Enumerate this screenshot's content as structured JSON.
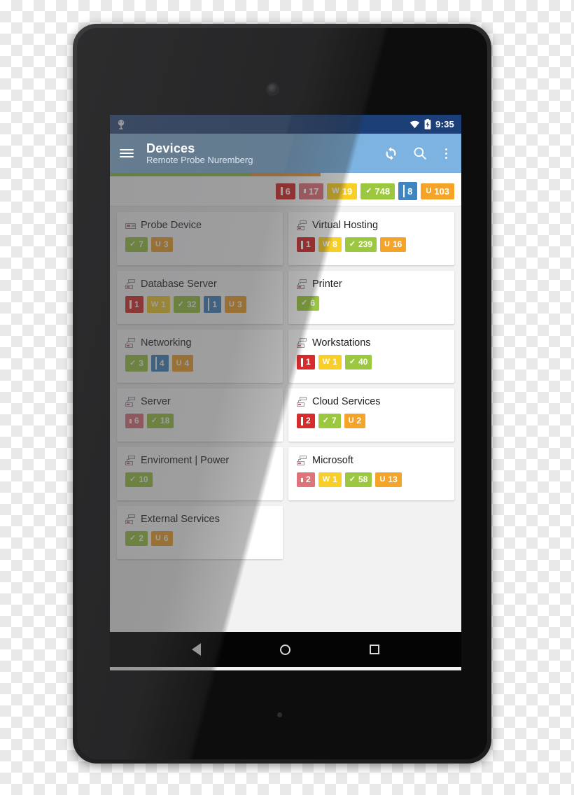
{
  "status_bar": {
    "app_icon": "prtg-probe-icon",
    "wifi_icon": "wifi-icon",
    "battery_icon": "battery-charging-icon",
    "time": "9:35"
  },
  "app_bar": {
    "menu_icon": "hamburger-menu-icon",
    "title": "Devices",
    "subtitle": "Remote Probe Nuremberg",
    "refresh_icon": "refresh-icon",
    "search_icon": "search-icon",
    "overflow_icon": "overflow-menu-icon"
  },
  "progress": {
    "green_percent": 40,
    "orange_percent": 20,
    "green_color": "#8ec640",
    "orange_color": "#ee9b33"
  },
  "status_colors": {
    "down": "#d92b2b",
    "down_acknowledged": "#e0737a",
    "warning": "#f7cf28",
    "up": "#9cc840",
    "paused": "#3f86c0",
    "unknown": "#f5a42a"
  },
  "totals": [
    {
      "icon": "down-icon",
      "glyph": "dots4",
      "count": "6",
      "state": "down"
    },
    {
      "icon": "down-ack-icon",
      "glyph": "colon",
      "count": "17",
      "state": "down_acknowledged"
    },
    {
      "icon": "warning-icon",
      "glyph": "W",
      "count": "19",
      "state": "warning"
    },
    {
      "icon": "up-icon",
      "glyph": "check",
      "count": "748",
      "state": "up"
    },
    {
      "icon": "paused-icon",
      "glyph": "pause",
      "count": "8",
      "state": "paused"
    },
    {
      "icon": "unknown-icon",
      "glyph": "U",
      "count": "103",
      "state": "unknown"
    }
  ],
  "cards": [
    {
      "title": "Probe Device",
      "icon": "probe-device-icon",
      "badges": [
        {
          "glyph": "check",
          "count": "7",
          "state": "up"
        },
        {
          "glyph": "U",
          "count": "3",
          "state": "unknown"
        }
      ]
    },
    {
      "title": "Virtual Hosting",
      "icon": "device-group-icon",
      "badges": [
        {
          "glyph": "dots4",
          "count": "1",
          "state": "down"
        },
        {
          "glyph": "W",
          "count": "8",
          "state": "warning"
        },
        {
          "glyph": "check",
          "count": "239",
          "state": "up"
        },
        {
          "glyph": "U",
          "count": "16",
          "state": "unknown"
        }
      ]
    },
    {
      "title": "Database Server",
      "icon": "device-group-icon",
      "badges": [
        {
          "glyph": "dots4",
          "count": "1",
          "state": "down"
        },
        {
          "glyph": "W",
          "count": "1",
          "state": "warning"
        },
        {
          "glyph": "check",
          "count": "32",
          "state": "up"
        },
        {
          "glyph": "pause",
          "count": "1",
          "state": "paused"
        },
        {
          "glyph": "U",
          "count": "3",
          "state": "unknown"
        }
      ]
    },
    {
      "title": "Printer",
      "icon": "device-group-icon",
      "badges": [
        {
          "glyph": "check",
          "count": "6",
          "state": "up"
        }
      ]
    },
    {
      "title": "Networking",
      "icon": "device-group-icon",
      "badges": [
        {
          "glyph": "check",
          "count": "3",
          "state": "up"
        },
        {
          "glyph": "pause",
          "count": "4",
          "state": "paused"
        },
        {
          "glyph": "U",
          "count": "4",
          "state": "unknown"
        }
      ]
    },
    {
      "title": "Workstations",
      "icon": "device-group-icon",
      "badges": [
        {
          "glyph": "dots4",
          "count": "1",
          "state": "down"
        },
        {
          "glyph": "W",
          "count": "1",
          "state": "warning"
        },
        {
          "glyph": "check",
          "count": "40",
          "state": "up"
        }
      ]
    },
    {
      "title": "Server",
      "icon": "device-group-icon",
      "badges": [
        {
          "glyph": "colon",
          "count": "6",
          "state": "down_acknowledged"
        },
        {
          "glyph": "check",
          "count": "18",
          "state": "up"
        }
      ]
    },
    {
      "title": "Cloud Services",
      "icon": "device-group-icon",
      "badges": [
        {
          "glyph": "dots4",
          "count": "2",
          "state": "down"
        },
        {
          "glyph": "check",
          "count": "7",
          "state": "up"
        },
        {
          "glyph": "U",
          "count": "2",
          "state": "unknown"
        }
      ]
    },
    {
      "title": "Enviroment | Power",
      "icon": "device-group-icon",
      "badges": [
        {
          "glyph": "check",
          "count": "10",
          "state": "up"
        }
      ]
    },
    {
      "title": "Microsoft",
      "icon": "device-group-icon",
      "badges": [
        {
          "glyph": "colon",
          "count": "2",
          "state": "down_acknowledged"
        },
        {
          "glyph": "W",
          "count": "1",
          "state": "warning"
        },
        {
          "glyph": "check",
          "count": "58",
          "state": "up"
        },
        {
          "glyph": "U",
          "count": "13",
          "state": "unknown"
        }
      ]
    },
    {
      "title": "External Services",
      "icon": "device-group-icon",
      "badges": [
        {
          "glyph": "check",
          "count": "2",
          "state": "up"
        },
        {
          "glyph": "U",
          "count": "6",
          "state": "unknown"
        }
      ]
    }
  ],
  "nav_bar": {
    "back_icon": "back-triangle-icon",
    "home_icon": "home-circle-icon",
    "recents_icon": "recents-square-icon"
  }
}
